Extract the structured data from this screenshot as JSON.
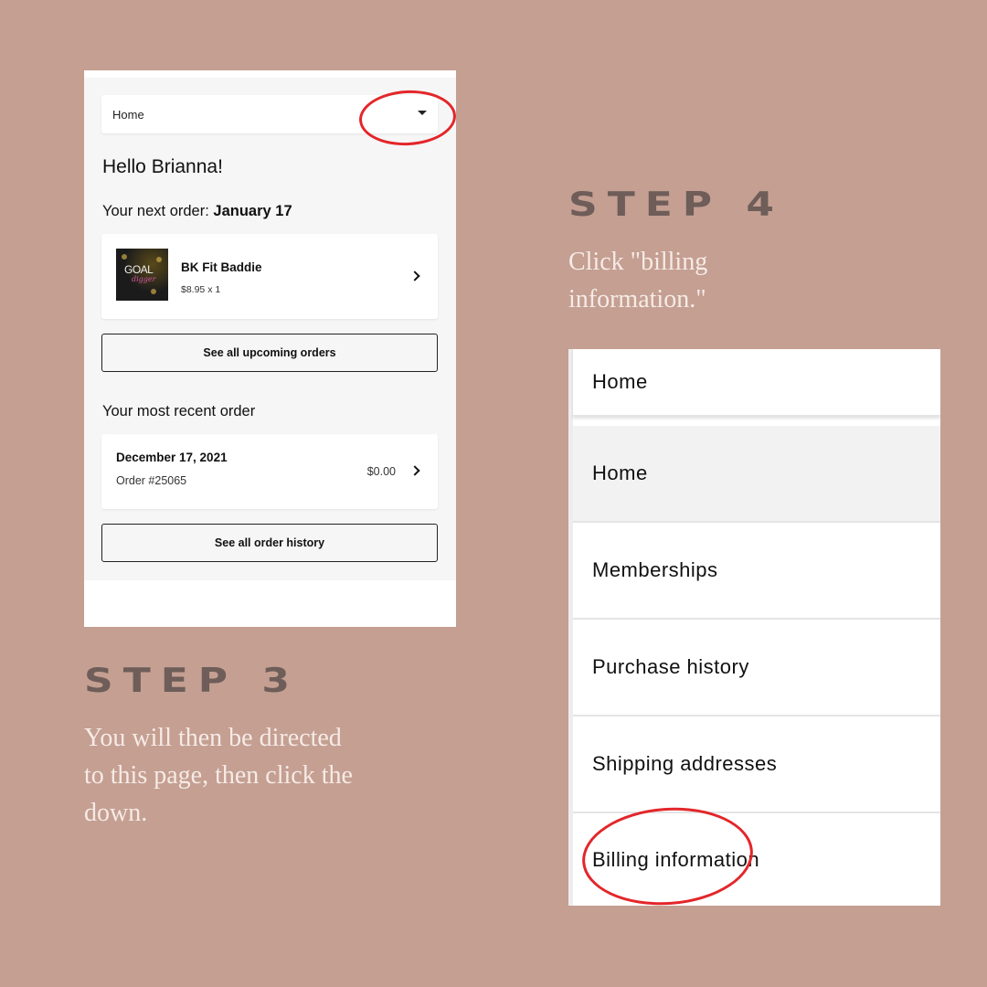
{
  "step3": {
    "title": "STEP 3",
    "description": "You will then be directed to this page, then click the down."
  },
  "step4": {
    "title": "STEP 4",
    "description": "Click \"billing information.\""
  },
  "account_page": {
    "select_value": "Home",
    "greeting": "Hello Brianna!",
    "next_order_label": "Your next order:",
    "next_order_date": "January 17",
    "product": {
      "image_text": "GOAL",
      "image_subtext": "digger",
      "name": "BK Fit Baddie",
      "price_qty": "$8.95 x 1"
    },
    "upcoming_button": "See all upcoming orders",
    "recent_title": "Your most recent order",
    "recent_order": {
      "date": "December 17, 2021",
      "number": "Order #25065",
      "amount": "$0.00"
    },
    "history_button": "See all order history"
  },
  "menu": {
    "selected": "Home",
    "items": [
      "Home",
      "Memberships",
      "Purchase history",
      "Shipping addresses",
      "Billing information"
    ]
  },
  "colors": {
    "background": "#c49f92",
    "step_heading": "#6e5d58",
    "step_text": "#f6ebe6",
    "highlight": "#e3262a"
  }
}
